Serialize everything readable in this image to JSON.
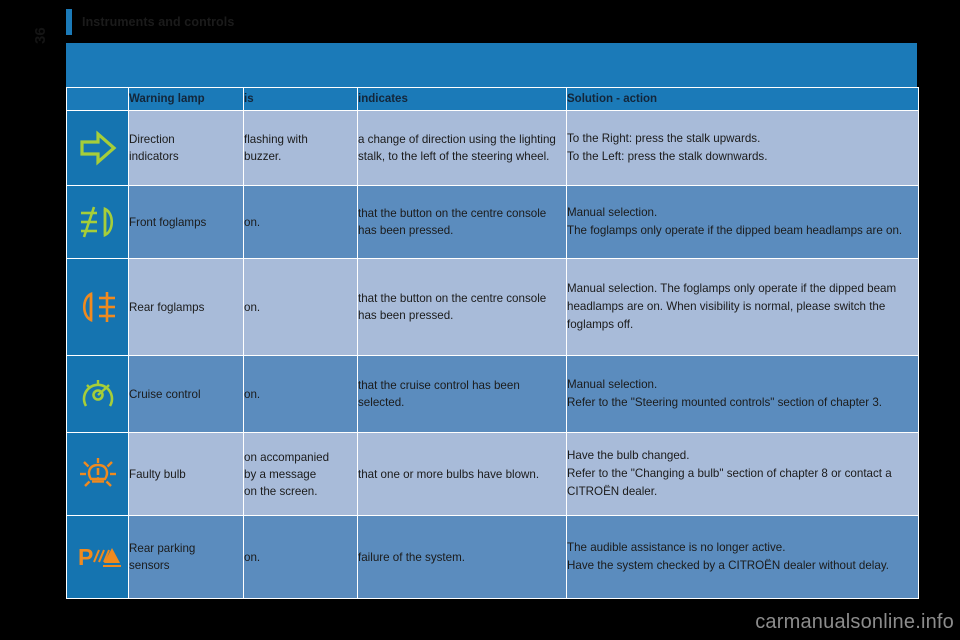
{
  "chapter": {
    "title": "Instruments and controls",
    "page_number": "36",
    "accent_color": "#1b7ab8"
  },
  "table": {
    "headers": {
      "icon": "",
      "lamp": "Warning lamp",
      "is": "is",
      "indicates": "indicates",
      "solution": "Solution - action"
    },
    "rows": [
      {
        "icon_name": "direction-indicator-arrow-icon",
        "icon_color": "#a6ce39",
        "lamp": "Direction indicators",
        "lamp_line1": "Direction",
        "lamp_line2": "indicators",
        "is_line1": "flashing with",
        "is_line2": "buzzer.",
        "indicates": "a change of direction using the lighting stalk, to the left of the steering wheel.",
        "solution_line1": "To the Right: press the stalk upwards.",
        "solution_line2": "To the Left: press the stalk downwards.",
        "shade": "light"
      },
      {
        "icon_name": "front-foglamp-icon",
        "icon_color": "#a6ce39",
        "lamp": "Front foglamps",
        "lamp_line1": "Front foglamps",
        "lamp_line2": "",
        "is_line1": "on.",
        "is_line2": "",
        "indicates": "that the button on the centre console has been pressed.",
        "solution_line1": "Manual selection.",
        "solution_line2": "The foglamps only operate if the dipped beam headlamps are on.",
        "shade": "dark"
      },
      {
        "icon_name": "rear-foglamp-icon",
        "icon_color": "#f08a1e",
        "lamp": "Rear foglamps",
        "lamp_line1": "Rear foglamps",
        "lamp_line2": "",
        "is_line1": "on.",
        "is_line2": "",
        "indicates": "that the button on the centre console has been pressed.",
        "solution_line1": "Manual selection. The foglamps only operate if the dipped beam headlamps are on. When visibility is normal, please switch the foglamps off.",
        "solution_line2": "",
        "shade": "light"
      },
      {
        "icon_name": "cruise-control-icon",
        "icon_color": "#a6ce39",
        "lamp": "Cruise control",
        "lamp_line1": "Cruise control",
        "lamp_line2": "",
        "is_line1": "on.",
        "is_line2": "",
        "indicates": "that the cruise control has been selected.",
        "solution_line1": "Manual selection.",
        "solution_line2": "Refer to the \"Steering mounted controls\" section of chapter 3.",
        "shade": "dark"
      },
      {
        "icon_name": "faulty-bulb-icon",
        "icon_color": "#f08a1e",
        "lamp": "Faulty bulb",
        "lamp_line1": "Faulty bulb",
        "lamp_line2": "",
        "is_line1": "on accompanied",
        "is_line2": "by a message",
        "is_line3": "on the screen.",
        "indicates": "that one or more bulbs have blown.",
        "solution_line1": "Have the bulb changed.",
        "solution_line2": "Refer to the \"Changing a bulb\" section of chapter 8 or contact a CITROËN dealer.",
        "shade": "light"
      },
      {
        "icon_name": "rear-parking-sensors-icon",
        "icon_color": "#f08a1e",
        "lamp": "Rear parking sensors",
        "lamp_line1": "Rear parking",
        "lamp_line2": "sensors",
        "is_line1": "on.",
        "is_line2": "",
        "indicates": "failure of the system.",
        "solution_line1": "The audible assistance is no longer active.",
        "solution_line2": "Have the system checked by a CITROËN dealer without delay.",
        "shade": "dark"
      }
    ]
  },
  "watermark": {
    "text": "carmanualsonline.info"
  }
}
